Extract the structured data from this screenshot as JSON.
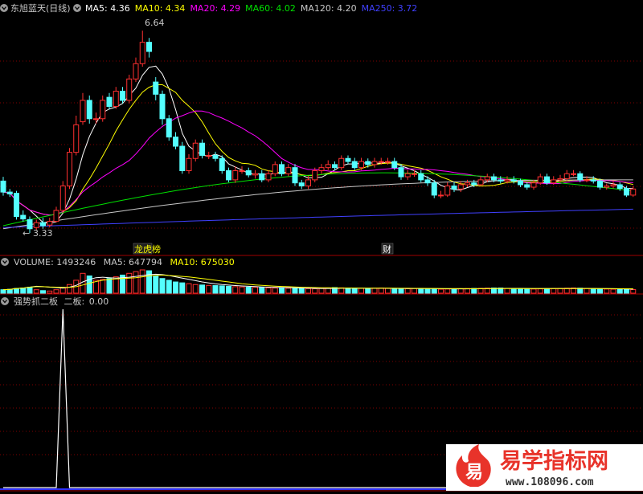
{
  "price_panel": {
    "title": "东旭蓝天(日线)",
    "ma": [
      {
        "label": "MA5:",
        "value": "4.36",
        "color": "#ffffff"
      },
      {
        "label": "MA10:",
        "value": "4.34",
        "color": "#ffff00"
      },
      {
        "label": "MA20:",
        "value": "4.29",
        "color": "#ff00ff"
      },
      {
        "label": "MA60:",
        "value": "4.02",
        "color": "#00e000"
      },
      {
        "label": "MA120:",
        "value": "4.20",
        "color": "#c8c8c8"
      },
      {
        "label": "MA250:",
        "value": "3.72",
        "color": "#4040ff"
      }
    ],
    "high_label": "6.64",
    "low_label": "3.33",
    "markers": [
      {
        "text": "龙虎榜",
        "color": "#ffff00"
      },
      {
        "text": "财",
        "color": "#ffffff"
      }
    ]
  },
  "volume_panel": {
    "label": "VOLUME:",
    "value": "1493246",
    "ma5_label": "MA5:",
    "ma5_value": "647794",
    "ma10_label": "MA10:",
    "ma10_value": "675030"
  },
  "indicator_panel": {
    "title": "强势抓二板",
    "series_label": "二板:",
    "series_value": "0.00"
  },
  "watermark": {
    "glyph": "易",
    "title": "易学指标网",
    "url": "www.108096.com"
  },
  "chart_data": {
    "type": "candlestick",
    "title": "东旭蓝天(日线)",
    "price_series": {
      "open": [
        4.18,
        4.0,
        3.98,
        3.62,
        3.55,
        3.42,
        3.5,
        3.46,
        3.52,
        3.7,
        4.1,
        4.65,
        5.15,
        5.5,
        5.2,
        5.2,
        5.55,
        5.4,
        5.65,
        5.5,
        5.85,
        6.1,
        6.45,
        5.8,
        5.6,
        5.2,
        4.9,
        4.75,
        4.35,
        4.55,
        4.8,
        4.6,
        4.6,
        4.55,
        4.35,
        4.2,
        4.35,
        4.35,
        4.28,
        4.3,
        4.2,
        4.3,
        4.45,
        4.3,
        4.4,
        4.15,
        4.1,
        4.2,
        4.35,
        4.4,
        4.45,
        4.4,
        4.55,
        4.5,
        4.4,
        4.5,
        4.45,
        4.5,
        4.5,
        4.5,
        4.4,
        4.25,
        4.3,
        4.3,
        4.2,
        4.15,
        3.95,
        3.95,
        4.1,
        4.05,
        4.12,
        4.15,
        4.12,
        4.2,
        4.25,
        4.2,
        4.18,
        4.2,
        4.18,
        4.12,
        4.08,
        4.15,
        4.25,
        4.15,
        4.2,
        4.22,
        4.3,
        4.3,
        4.2,
        4.2,
        4.18,
        4.08,
        4.1,
        4.12,
        4.06,
        3.95
      ],
      "close": [
        4.0,
        3.97,
        3.6,
        3.56,
        3.4,
        3.5,
        3.45,
        3.52,
        3.7,
        4.1,
        4.65,
        5.1,
        5.5,
        5.2,
        5.2,
        5.5,
        5.4,
        5.65,
        5.5,
        5.85,
        6.1,
        6.45,
        6.3,
        5.6,
        5.2,
        4.9,
        4.75,
        4.35,
        4.55,
        4.8,
        4.6,
        4.6,
        4.55,
        4.35,
        4.2,
        4.35,
        4.35,
        4.28,
        4.3,
        4.2,
        4.3,
        4.45,
        4.3,
        4.4,
        4.15,
        4.1,
        4.2,
        4.35,
        4.4,
        4.45,
        4.4,
        4.55,
        4.5,
        4.4,
        4.5,
        4.45,
        4.5,
        4.5,
        4.5,
        4.4,
        4.25,
        4.3,
        4.3,
        4.2,
        4.15,
        3.95,
        3.95,
        4.1,
        4.05,
        4.12,
        4.15,
        4.12,
        4.2,
        4.25,
        4.2,
        4.18,
        4.2,
        4.18,
        4.12,
        4.08,
        4.15,
        4.25,
        4.15,
        4.2,
        4.22,
        4.3,
        4.3,
        4.2,
        4.2,
        4.18,
        4.08,
        4.1,
        4.12,
        4.06,
        3.95,
        4.05
      ],
      "high": [
        4.25,
        4.05,
        4.02,
        3.7,
        3.6,
        3.55,
        3.58,
        3.58,
        3.76,
        4.18,
        4.72,
        5.25,
        5.62,
        5.58,
        5.3,
        5.58,
        5.62,
        5.72,
        5.72,
        5.92,
        6.2,
        6.64,
        6.52,
        5.88,
        5.66,
        5.26,
        4.98,
        4.82,
        4.62,
        4.86,
        4.86,
        4.66,
        4.66,
        4.6,
        4.4,
        4.42,
        4.42,
        4.4,
        4.36,
        4.36,
        4.36,
        4.5,
        4.5,
        4.46,
        4.46,
        4.2,
        4.26,
        4.4,
        4.46,
        4.52,
        4.5,
        4.6,
        4.6,
        4.56,
        4.56,
        4.55,
        4.56,
        4.56,
        4.56,
        4.56,
        4.46,
        4.36,
        4.36,
        4.36,
        4.26,
        4.2,
        4.02,
        4.16,
        4.16,
        4.18,
        4.2,
        4.2,
        4.26,
        4.3,
        4.3,
        4.26,
        4.26,
        4.26,
        4.22,
        4.16,
        4.2,
        4.3,
        4.3,
        4.26,
        4.28,
        4.36,
        4.36,
        4.34,
        4.26,
        4.26,
        4.22,
        4.14,
        4.18,
        4.16,
        4.1,
        4.1
      ],
      "low": [
        3.94,
        3.92,
        3.55,
        3.52,
        3.33,
        3.38,
        3.4,
        3.42,
        3.5,
        3.66,
        4.05,
        4.6,
        5.1,
        5.12,
        5.12,
        5.15,
        5.35,
        5.36,
        5.45,
        5.45,
        5.8,
        6.05,
        6.2,
        5.5,
        5.1,
        4.84,
        4.7,
        4.3,
        4.3,
        4.5,
        4.55,
        4.54,
        4.5,
        4.3,
        4.16,
        4.15,
        4.3,
        4.24,
        4.22,
        4.16,
        4.16,
        4.26,
        4.26,
        4.26,
        4.1,
        4.05,
        4.05,
        4.16,
        4.3,
        4.36,
        4.36,
        4.36,
        4.46,
        4.36,
        4.36,
        4.4,
        4.4,
        4.45,
        4.45,
        4.36,
        4.2,
        4.2,
        4.25,
        4.16,
        4.1,
        3.9,
        3.9,
        3.92,
        4.0,
        4.0,
        4.08,
        4.08,
        4.1,
        4.16,
        4.16,
        4.14,
        4.14,
        4.14,
        4.08,
        4.04,
        4.04,
        4.12,
        4.12,
        4.12,
        4.16,
        4.18,
        4.26,
        4.16,
        4.16,
        4.14,
        4.04,
        4.04,
        4.06,
        4.02,
        3.92,
        3.92
      ]
    },
    "volume": [
      40,
      45,
      55,
      60,
      70,
      40,
      30,
      25,
      40,
      60,
      100,
      150,
      230,
      200,
      150,
      160,
      170,
      190,
      210,
      230,
      250,
      270,
      260,
      200,
      170,
      150,
      130,
      120,
      110,
      100,
      95,
      90,
      88,
      85,
      80,
      75,
      72,
      70,
      68,
      65,
      62,
      60,
      62,
      58,
      56,
      54,
      53,
      52,
      55,
      60,
      65,
      62,
      60,
      58,
      56,
      55,
      58,
      60,
      55,
      52,
      50,
      52,
      54,
      56,
      50,
      48,
      46,
      48,
      50,
      52,
      54,
      55,
      56,
      58,
      60,
      60,
      56,
      54,
      52,
      50,
      48,
      50,
      52,
      54,
      56,
      58,
      60,
      58,
      55,
      52,
      50,
      48,
      46,
      45,
      44,
      42
    ],
    "volume_ma5": [
      40,
      45,
      55,
      60,
      70,
      80,
      75,
      70,
      65,
      60,
      70,
      90,
      130,
      160,
      180,
      185,
      180,
      175,
      180,
      185,
      195,
      205,
      215,
      220,
      215,
      205,
      190,
      175,
      160,
      145,
      130,
      118,
      108,
      100,
      94,
      88,
      84,
      80,
      76,
      73,
      70,
      68,
      66,
      64,
      62,
      60,
      58,
      56,
      55,
      55,
      56,
      57,
      58,
      58,
      58,
      57,
      57,
      57,
      57,
      56,
      55,
      54,
      54,
      54,
      54,
      53,
      52,
      51,
      50,
      50,
      50,
      51,
      52,
      53,
      54,
      55,
      56,
      56,
      56,
      55,
      54,
      53,
      53,
      53,
      53,
      54,
      55,
      55,
      55,
      55,
      54,
      53,
      52,
      50,
      48,
      47
    ],
    "volume_ma10": [
      40,
      45,
      55,
      60,
      70,
      75,
      75,
      72,
      70,
      68,
      68,
      75,
      95,
      115,
      135,
      150,
      160,
      165,
      170,
      175,
      180,
      190,
      200,
      205,
      210,
      205,
      200,
      195,
      188,
      180,
      170,
      160,
      150,
      140,
      130,
      120,
      110,
      102,
      96,
      90,
      86,
      82,
      78,
      75,
      72,
      69,
      67,
      65,
      63,
      62,
      61,
      60,
      60,
      60,
      59,
      59,
      58,
      58,
      58,
      58,
      57,
      57,
      56,
      56,
      55,
      55,
      54,
      54,
      53,
      53,
      52,
      52,
      52,
      52,
      53,
      53,
      53,
      53,
      53,
      53,
      53,
      53,
      53,
      53,
      53,
      53,
      53,
      53,
      53,
      53,
      53,
      52,
      52,
      52,
      51,
      51
    ],
    "indicator": {
      "name": "二板",
      "values": [
        0,
        0,
        0,
        0,
        0,
        0,
        0,
        0,
        0,
        1,
        0,
        0,
        0,
        0,
        0,
        0,
        0,
        0,
        0,
        0,
        0,
        0,
        0,
        0,
        0,
        0,
        0,
        0,
        0,
        0,
        0,
        0,
        0,
        0,
        0,
        0,
        0,
        0,
        0,
        0,
        0,
        0,
        0,
        0,
        0,
        0,
        0,
        0,
        0,
        0,
        0,
        0,
        0,
        0,
        0,
        0,
        0,
        0,
        0,
        0,
        0,
        0,
        0,
        0,
        0,
        0,
        0,
        0,
        0,
        0,
        0,
        0,
        0,
        0,
        0,
        0,
        0,
        0,
        0,
        0,
        0,
        0,
        0,
        0,
        0,
        0,
        0,
        0,
        0,
        0,
        0,
        0,
        0,
        0,
        0,
        0
      ],
      "last": "0.00"
    },
    "colors": {
      "up": "#ff3030",
      "down": "#54ffff",
      "volume_ma5": "#ffffff",
      "volume_ma10": "#ffff00"
    }
  }
}
